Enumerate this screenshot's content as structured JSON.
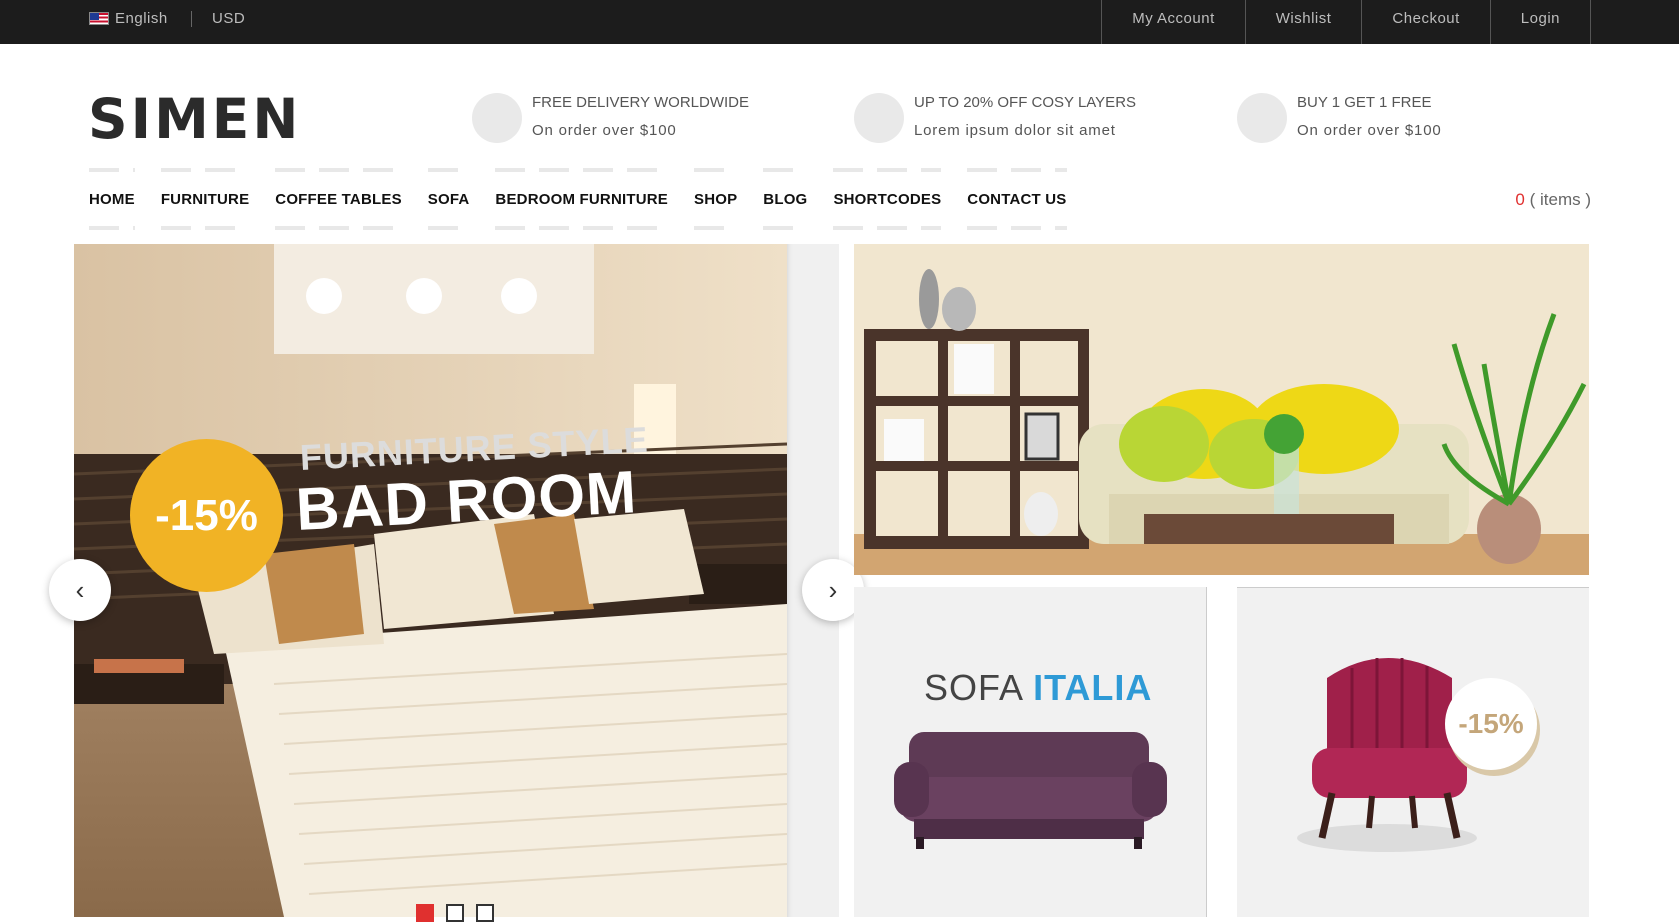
{
  "topbar": {
    "language": "English",
    "currency": "USD",
    "links": [
      "My Account",
      "Wishlist",
      "Checkout",
      "Login"
    ]
  },
  "header": {
    "logo": "SIMEN",
    "promos": [
      {
        "title": "FREE DELIVERY WORLDWIDE",
        "subtitle": "On order over $100"
      },
      {
        "title": "UP TO 20% OFF COSY LAYERS",
        "subtitle": "Lorem ipsum dolor sit amet"
      },
      {
        "title": "BUY 1 GET 1 FREE",
        "subtitle": "On order over $100"
      }
    ]
  },
  "nav": {
    "items": [
      "HOME",
      "FURNITURE",
      "COFFEE TABLES",
      "SOFA",
      "BEDROOM FURNITURE",
      "SHOP",
      "BLOG",
      "SHORTCODES",
      "CONTACT US"
    ],
    "cart_count": "0",
    "cart_label": "( items )"
  },
  "slider": {
    "badge": "-15%",
    "kicker": "FURNITURE STYLE",
    "title": "BAD ROOM",
    "prev_icon": "‹",
    "next_icon": "›",
    "active_dot": 1,
    "dot_count": 3
  },
  "banners": {
    "sofa_title_a": "SOFA",
    "sofa_title_b": "ITALIA",
    "chair_badge": "-15%"
  },
  "colors": {
    "topbar_bg": "#1c1c1c",
    "accent_red": "#e0302f",
    "badge_yellow": "#f1b325",
    "italia_blue": "#2e9ad6"
  }
}
